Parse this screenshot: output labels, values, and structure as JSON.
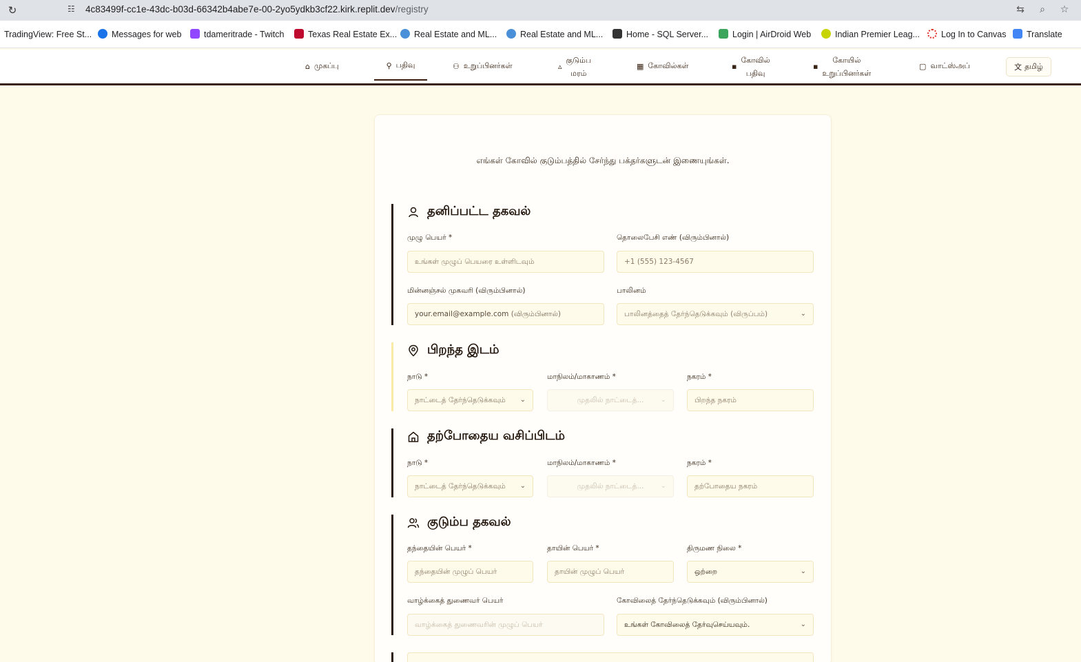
{
  "browser": {
    "url_host": "4c83499f-cc1e-43dc-b03d-66342b4abe7e-00-2yo5ydkb3cf22.kirk.replit.dev",
    "url_path": "/registry",
    "bookmarks": [
      {
        "label": "TradingView: Free St...",
        "color": "#1e1e1e"
      },
      {
        "label": "Messages for web",
        "color": "#1a73e8"
      },
      {
        "label": "tdameritrade - Twitch",
        "color": "#9146ff"
      },
      {
        "label": "Texas Real Estate Ex...",
        "color": "#bf0a30"
      },
      {
        "label": "Real Estate and ML...",
        "color": "#4a90d9"
      },
      {
        "label": "Real Estate and ML...",
        "color": "#4a90d9"
      },
      {
        "label": "Home - SQL Server...",
        "color": "#333333"
      },
      {
        "label": "Login | AirDroid Web",
        "color": "#3ba55c"
      },
      {
        "label": "Indian Premier Leag...",
        "color": "#c8d400"
      },
      {
        "label": "Log In to Canvas",
        "color": "#e0312a"
      },
      {
        "label": "Translate",
        "color": "#4285f4"
      }
    ]
  },
  "nav": {
    "home": "முகப்பு",
    "register": "பதிவு",
    "members": "உறுப்பினர்கள்",
    "family_tree_1": "குடும்ப",
    "family_tree_2": "மரம்",
    "temples": "கோவில்கள்",
    "temple_reg_1": "கோவில்",
    "temple_reg_2": "பதிவு",
    "temple_members_1": "கோயில்",
    "temple_members_2": "உறுப்பினர்கள்",
    "whatsapp": "வாட்ஸ்அப்",
    "language": "தமிழ்"
  },
  "form": {
    "subtitle": "எங்கள் கோவில் குடும்பத்தில் சேர்ந்து பக்தர்களுடன் இணையுங்கள்.",
    "personal": {
      "title": "தனிப்பட்ட தகவல்",
      "full_name_label": "முழு பெயர் *",
      "full_name_placeholder": "உங்கள் முழுப் பெயரை உள்ளிடவும்",
      "phone_label": "தொலைபேசி எண் (விரும்பினால்)",
      "phone_placeholder": "+1 (555) 123-4567",
      "email_label": "மின்னஞ்சல் முகவரி (விரும்பினால்)",
      "email_placeholder_en": "your.email@example.com",
      "email_placeholder_ta": "(விரும்பினால்)",
      "gender_label": "பாலினம்",
      "gender_placeholder": "பாலினத்தைத் தேர்ந்தெடுக்கவும் (விருப்பம்)"
    },
    "birthplace": {
      "title": "பிறந்த இடம்",
      "country_label": "நாடு *",
      "country_placeholder": "நாட்டைத் தேர்ந்தெடுக்கவும்",
      "state_label": "மாநிலம்/மாகாணம் *",
      "state_placeholder": "முதலில் நாட்டைத்...",
      "city_label": "நகரம் *",
      "city_placeholder": "பிறந்த நகரம்"
    },
    "residence": {
      "title": "தற்போதைய வசிப்பிடம்",
      "country_label": "நாடு *",
      "country_placeholder": "நாட்டைத் தேர்ந்தெடுக்கவும்",
      "state_label": "மாநிலம்/மாகாணம் *",
      "state_placeholder": "முதலில் நாட்டைத்...",
      "city_label": "நகரம் *",
      "city_placeholder": "தற்போதைய நகரம்"
    },
    "family": {
      "title": "குடும்ப தகவல்",
      "father_label": "தந்தையின் பெயர் *",
      "father_placeholder": "தந்தையின் முழுப் பெயர்",
      "mother_label": "தாயின் பெயர் *",
      "mother_placeholder": "தாயின் முழுப் பெயர்",
      "marital_label": "திருமண நிலை *",
      "marital_value": "ஒற்றை",
      "spouse_label": "வாழ்க்கைத் துணைவர் பெயர்",
      "spouse_placeholder": "வாழ்க்கைத் துணைவரின் முழுப் பெயர்",
      "temple_label": "கோவிலைத் தேர்ந்தெடுக்கவும் (விரும்பினால்)",
      "temple_placeholder": "உங்கள் கோவிலைத் தேர்வுசெய்யவும்."
    }
  }
}
